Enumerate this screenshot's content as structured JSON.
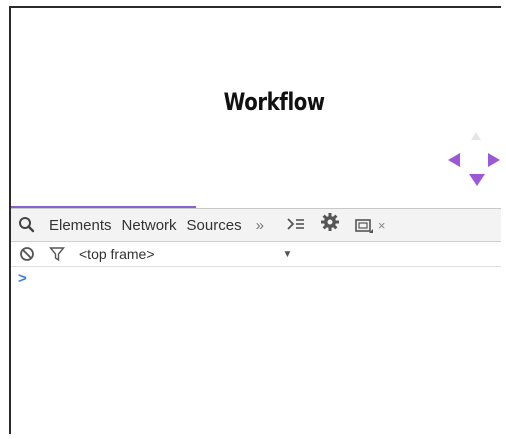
{
  "page": {
    "title": "Workflow"
  },
  "devtools": {
    "tabs": [
      {
        "label": "Elements"
      },
      {
        "label": "Network"
      },
      {
        "label": "Sources"
      }
    ],
    "more_label": "»",
    "console_drawer_icon": "console-drawer-icon",
    "close_label": "×",
    "context_label": "<top frame>",
    "context_caret": "▼",
    "prompt_symbol": ">"
  },
  "colors": {
    "accent_purple": "#9b59d6",
    "prompt_blue": "#367cf1",
    "tabbar_bg": "#f3f3f3"
  }
}
